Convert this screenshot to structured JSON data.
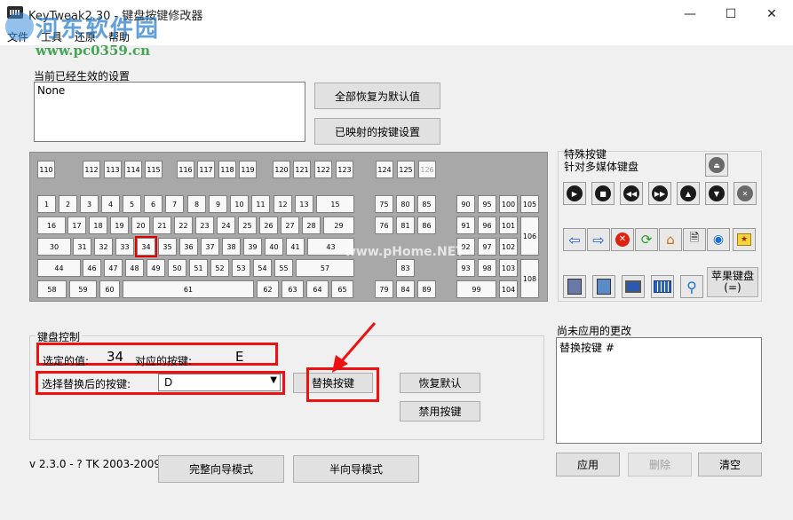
{
  "window": {
    "title": "KeyTweak2.30 - 键盘按键修改器",
    "minimize": "—",
    "maximize": "☐",
    "close": "✕"
  },
  "menu": [
    "文件",
    "工具",
    "还原",
    "帮助"
  ],
  "watermark": {
    "title": "河东软件园",
    "url": "www.pc0359.cn",
    "center": "www.pHome.NET"
  },
  "current": {
    "label": "当前已经生效的设置",
    "value": "None",
    "restore_all": "全部恢复为默认值",
    "mapped": "已映射的按键设置"
  },
  "keyboard": {
    "fkeys": [
      "110",
      "112",
      "113",
      "114",
      "115",
      "116",
      "117",
      "118",
      "119",
      "120",
      "121",
      "122",
      "123",
      "124",
      "125",
      "126"
    ],
    "row1": [
      "1",
      "2",
      "3",
      "4",
      "5",
      "6",
      "7",
      "8",
      "9",
      "10",
      "11",
      "12",
      "13",
      "15"
    ],
    "row2": [
      "16",
      "17",
      "18",
      "19",
      "20",
      "21",
      "22",
      "23",
      "24",
      "25",
      "26",
      "27",
      "28",
      "29"
    ],
    "row3": [
      "30",
      "31",
      "32",
      "33",
      "34",
      "35",
      "36",
      "37",
      "38",
      "39",
      "40",
      "41",
      "43"
    ],
    "row4": [
      "44",
      "46",
      "47",
      "48",
      "49",
      "50",
      "51",
      "52",
      "53",
      "54",
      "55",
      "57"
    ],
    "row5": [
      "58",
      "59",
      "60",
      "61",
      "62",
      "63",
      "64",
      "65"
    ],
    "nav": [
      "75",
      "80",
      "85",
      "76",
      "81",
      "86",
      "83",
      "79",
      "84",
      "89"
    ],
    "numpad": [
      "90",
      "95",
      "100",
      "105",
      "91",
      "96",
      "101",
      "106",
      "92",
      "97",
      "102",
      "93",
      "98",
      "103",
      "108",
      "99",
      "104"
    ],
    "selected_key": "34"
  },
  "special": {
    "title": "特殊按键",
    "subtitle": "针对多媒体键盘",
    "apple": "苹果键盘\n(=)"
  },
  "control": {
    "group_label": "键盘控制",
    "selected_value_label": "选定的值:",
    "selected_value": "34",
    "mapped_key_label": "对应的按键:",
    "mapped_key": "E",
    "replace_label": "选择替换后的按键:",
    "replace_value": "D",
    "replace_button": "替换按键",
    "restore_default": "恢复默认",
    "disable_key": "禁用按键"
  },
  "pending": {
    "label": "尚未应用的更改",
    "text": "替换按键 #",
    "apply": "应用",
    "delete": "删除",
    "clear": "清空"
  },
  "footer": {
    "version": "v 2.3.0 - ? TK 2003-2009",
    "full_wizard": "完整向导模式",
    "half_wizard": "半向导模式"
  },
  "colors": {
    "highlight": "#e11111",
    "arrow": "#e11111"
  }
}
